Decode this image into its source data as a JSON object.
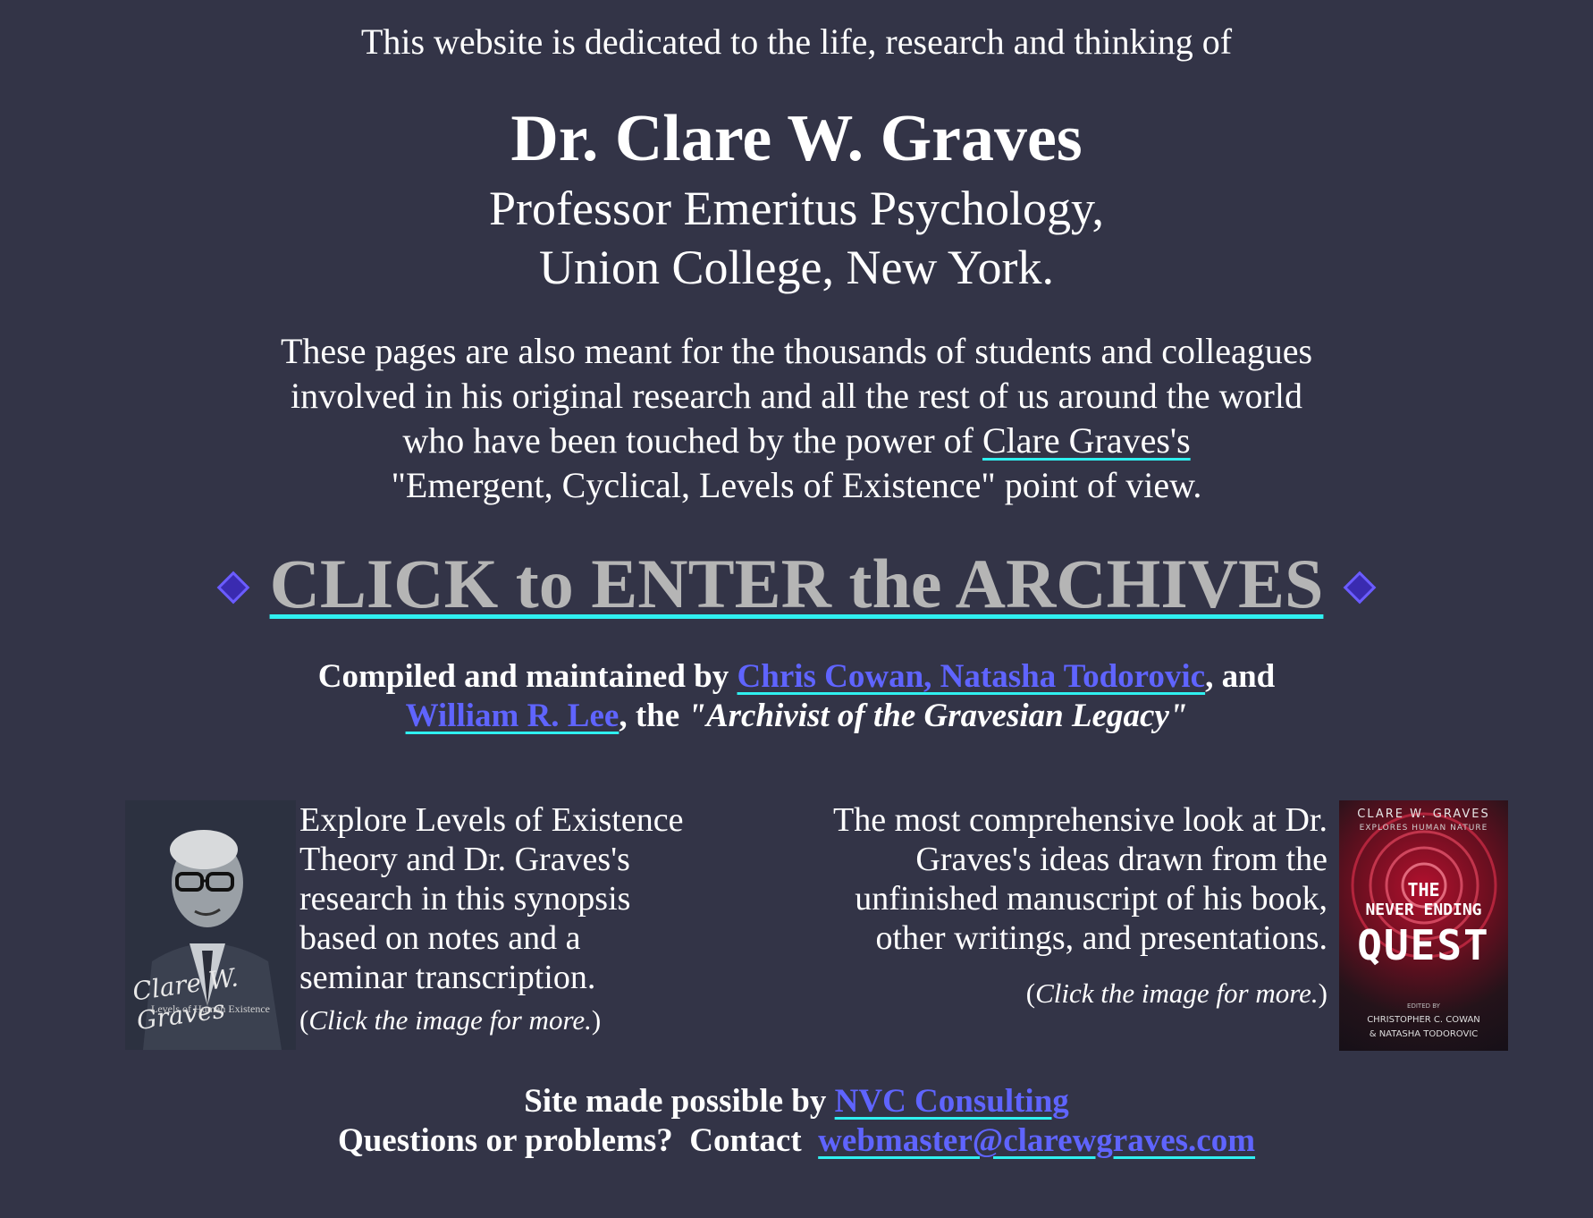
{
  "intro": "This website is dedicated to the life, research and thinking of",
  "title": "Dr. Clare W. Graves",
  "subtitle_line1": "Professor Emeritus Psychology,",
  "subtitle_line2": "Union College, New York.",
  "purpose": {
    "line1": "These pages are also meant for the thousands of students and colleagues",
    "line2": "involved in his original research and all the rest of us around the world",
    "line3_prefix": "who have been touched by the power of ",
    "line3_link": "Clare Graves's",
    "line4": "\"Emergent, Cyclical, Levels of Existence\" point of view."
  },
  "archives_link": "CLICK to ENTER the ARCHIVES",
  "compiled": {
    "prefix": "Compiled and maintained by ",
    "link1": "Chris Cowan, Natasha Todorovic",
    "middle": ", and",
    "link2": "William R. Lee",
    "suffix": ", the ",
    "archivist": "\"Archivist of the Gravesian Legacy\""
  },
  "left_book": {
    "cover_title_script": "Clare W. Graves",
    "cover_subtitle": "Levels of Human Existence",
    "text_lines": [
      "Explore Levels of Existence",
      "Theory and Dr. Graves's",
      "research in this synopsis",
      "based on notes and a",
      "seminar transcription."
    ],
    "hint": "Click the image for more."
  },
  "right_book": {
    "cover_author": "CLARE W. GRAVES",
    "cover_tagline": "EXPLORES HUMAN NATURE",
    "cover_the": "THE",
    "cover_never": "NEVER ENDING",
    "cover_quest": "QUEST",
    "cover_edited": "EDITED BY",
    "cover_editors1": "CHRISTOPHER C. COWAN",
    "cover_editors2": "& NATASHA TODOROVIC",
    "text_lines": [
      "The most comprehensive look at Dr.",
      "Graves's ideas drawn from the",
      "unfinished manuscript of his book,",
      "other writings, and presentations."
    ],
    "hint": "Click the image for more."
  },
  "footer": {
    "line1_prefix": "Site made possible by ",
    "line1_link": "NVC Consulting",
    "line2_prefix": "Questions or problems?  Contact  ",
    "line2_link": "webmaster@clarewgraves.com"
  },
  "colors": {
    "background": "#333447",
    "link_blue": "#5f64ff",
    "underline_cyan": "#2ff0f0",
    "archives_gray": "#b5b5b5",
    "diamond_purple": "#3a2bb0"
  }
}
